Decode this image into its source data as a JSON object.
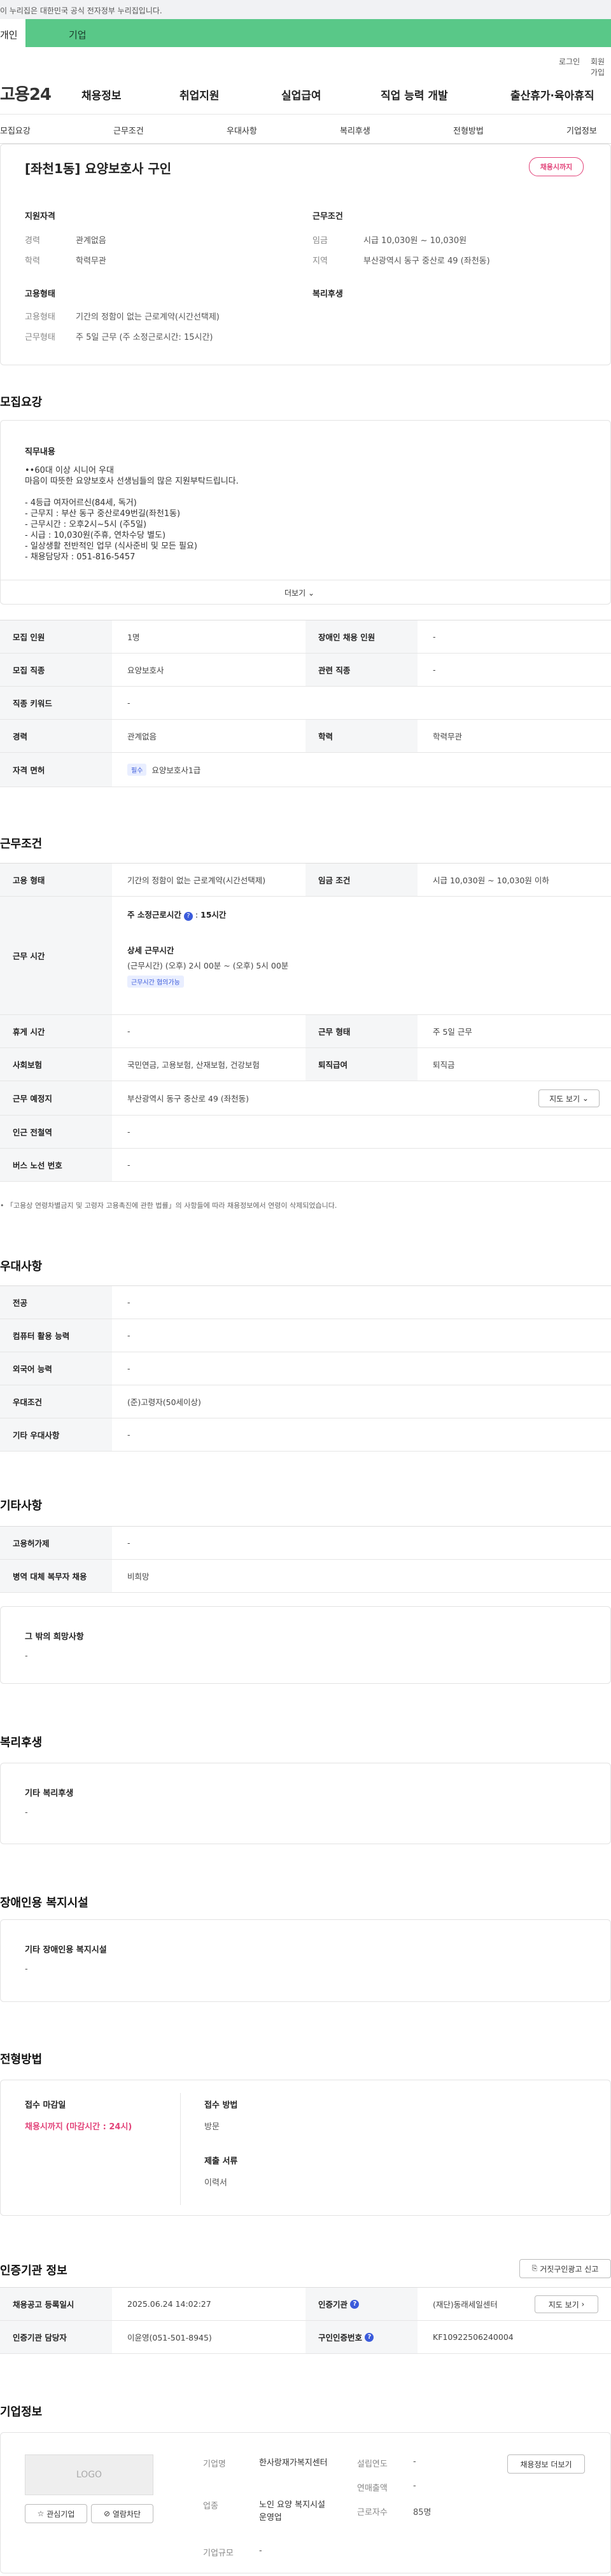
{
  "gov_notice": "이 누리집은 대한민국 공식 전자정부 누리집입니다.",
  "top_tabs": [
    "개인",
    "기업"
  ],
  "util": [
    "로그인",
    "회원가입"
  ],
  "logo": "고용24",
  "gnb": [
    "채용정보",
    "취업지원",
    "실업급여",
    "직업 능력 개발",
    "출산휴가·육아휴직"
  ],
  "subnav": [
    "모집요강",
    "근무조건",
    "우대사항",
    "복리후생",
    "전형방법",
    "기업정보"
  ],
  "job_title": "[좌천1동] 요양보호사 구인",
  "status_pill": "채용시까지",
  "summary": {
    "qual_title": "지원자격",
    "career_label": "경력",
    "career": "관계없음",
    "edu_label": "학력",
    "edu": "학력무관",
    "cond_title": "근무조건",
    "wage_label": "임금",
    "wage": "시급 10,030원 ~ 10,030원",
    "region_label": "지역",
    "region": "부산광역시 동구 중산로 49 (좌천동)",
    "emp_title": "고용형태",
    "emptype_label": "고용형태",
    "emptype": "기간의 정함이 없는 근로계약(시간선택제)",
    "worktype_label": "근무형태",
    "worktype": "주 5일 근무 (주 소정근로시간: 15시간)",
    "welfare_title": "복리후생"
  },
  "recruit": {
    "title": "모집요강",
    "duty_title": "직무내용",
    "duty_lines": [
      "••60대 이상 시니어 우대",
      "마음이 따뜻한 요양보호사 선생님들의 많은 지원부탁드립니다.",
      "",
      "- 4등급 여자어르신(84세, 독거)",
      "- 근무지 : 부산 동구 중산로49번길(좌천1동)",
      "- 근무시간 : 오후2시~5시 (주5일)",
      "- 시급 : 10,030원(주휴, 연차수당 별도)",
      "- 일상생활 전반적인 업무 (식사준비 및 모든 필요)",
      "- 채용담당자 : 051-816-5457"
    ],
    "more": "더보기",
    "rows": [
      {
        "l1": "모집 인원",
        "v1": "1명",
        "l2": "장애인 채용 인원",
        "v2": "-"
      },
      {
        "l1": "모집 직종",
        "v1": "요양보호사",
        "l2": "관련 직종",
        "v2": "-"
      },
      {
        "l1": "직종 키워드",
        "v1": "-"
      },
      {
        "l1": "경력",
        "v1": "관계없음",
        "l2": "학력",
        "v2": "학력무관"
      }
    ],
    "license_label": "자격 면허",
    "license_tag": "필수",
    "license": "요양보호사1급"
  },
  "workcond": {
    "title": "근무조건",
    "emptype_label": "고용 형태",
    "emptype": "기간의 정함이 없는 근로계약(시간선택제)",
    "wage_label": "임금 조건",
    "wage": "시급 10,030원 ~ 10,030원 이하",
    "hours_label": "근무 시간",
    "weekly_label": "주 소정근로시간",
    "weekly": "15시간",
    "detail_label": "상세 근무시간",
    "detail": "(근무시간) (오후) 2시 00분 ~ (오후) 5시 00분",
    "negotiable": "근무시간 협의가능",
    "rest_label": "휴게 시간",
    "rest": "-",
    "form_label": "근무 형태",
    "form": "주 5일 근무",
    "insure_label": "사회보험",
    "insure": "국민연금, 고용보험, 산재보험, 건강보험",
    "sev_label": "퇴직급여",
    "sev": "퇴직금",
    "place_label": "근무 예정지",
    "place": "부산광역시 동구 중산로 49 (좌천동)",
    "map_btn": "지도 보기",
    "station_label": "인근 전철역",
    "station": "-",
    "bus_label": "버스 노선 번호",
    "bus": "-",
    "notice": "「고용상 연령차별금지 및 고령자 고용촉진에 관한 법률」의 사항들에 따라 채용정보에서 연령이 삭제되었습니다."
  },
  "pref": {
    "title": "우대사항",
    "rows": [
      [
        "전공",
        "-"
      ],
      [
        "컴퓨터 활용 능력",
        "-"
      ],
      [
        "외국어 능력",
        "-"
      ],
      [
        "우대조건",
        "(준)고령자(50세이상)"
      ],
      [
        "기타 우대사항",
        "-"
      ]
    ]
  },
  "etc": {
    "title": "기타사항",
    "rows": [
      [
        "고용허가제",
        "-"
      ],
      [
        "병역 대체 복무자 채용",
        "비희망"
      ]
    ],
    "hope_title": "그 밖의 희망사항",
    "hope": "-"
  },
  "welfare": {
    "title": "복리후생",
    "sub": "기타 복리후생",
    "val": "-"
  },
  "disabled": {
    "title": "장애인용 복지시설",
    "sub": "기타 장애인용 복지시설",
    "val": "-"
  },
  "screening": {
    "title": "전형방법",
    "deadline_label": "접수 마감일",
    "deadline": "채용시까지 (마감시간 : 24시)",
    "method_label": "접수 방법",
    "method": "방문",
    "docs_label": "제출 서류",
    "docs": "이력서"
  },
  "cert": {
    "title": "인증기관 정보",
    "report_btn": "거짓구인광고 신고",
    "reg_label": "채용공고 등록일시",
    "reg": "2025.06.24 14:02:27",
    "org_label": "인증기관",
    "org": "(재단)동래세일센터",
    "map_btn": "지도 보기",
    "mgr_label": "인증기관 담당자",
    "mgr": "이윤영(051-501-8945)",
    "id_label": "구인인증번호",
    "id": "KF10922506240004"
  },
  "company": {
    "title": "기업정보",
    "logo": "LOGO",
    "fav_btn": "관심기업",
    "block_btn": "열람차단",
    "recruit_btn": "채용정보 더보기",
    "name_label": "기업명",
    "name": "한사랑재가복지센터",
    "year_label": "설립연도",
    "year": "-",
    "biz_label": "업종",
    "biz": "노인 요양 복지시설 운영업",
    "sales_label": "연매출액",
    "sales": "-",
    "emp_label": "근로자수",
    "emp": "85명",
    "size_label": "기업규모",
    "size": "-"
  }
}
